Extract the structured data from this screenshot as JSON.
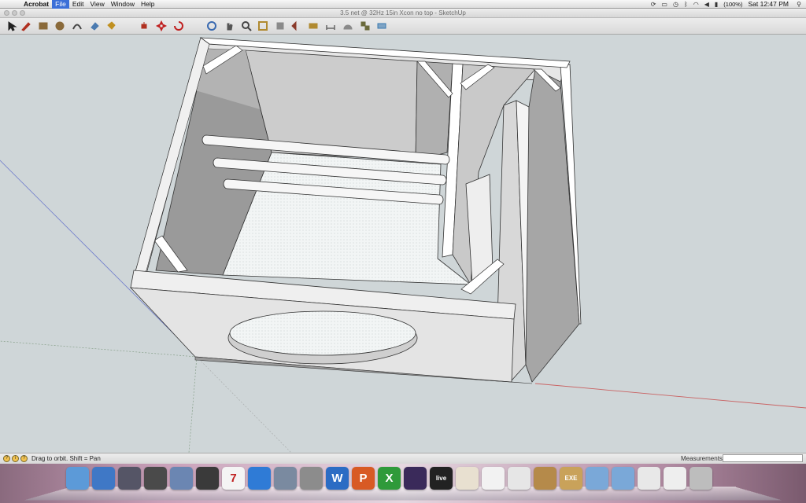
{
  "menubar": {
    "apple_glyph": "",
    "items": [
      "Acrobat",
      "File",
      "Edit",
      "View",
      "Window",
      "Help"
    ],
    "active_item": "File",
    "status": {
      "battery": "(100%)",
      "clock": "Sat 12:47 PM"
    }
  },
  "window": {
    "title": "3.5 net @ 32Hz 15in Xcon no top - SketchUp"
  },
  "toolbar": {
    "tools": [
      {
        "name": "select-tool-icon",
        "color": "#222222"
      },
      {
        "name": "pencil-tool-icon",
        "color": "#b03020"
      },
      {
        "name": "rectangle-tool-icon",
        "color": "#8a6a3a"
      },
      {
        "name": "circle-tool-icon",
        "color": "#8a6a3a"
      },
      {
        "name": "arc-tool-icon",
        "color": "#444444"
      },
      {
        "name": "eraser-tool-icon",
        "color": "#4a7ab0"
      },
      {
        "name": "paint-bucket-tool-icon",
        "color": "#c09020"
      },
      {
        "name": "push-pull-tool-icon",
        "color": "#b03020"
      },
      {
        "name": "move-tool-icon",
        "color": "#c02020"
      },
      {
        "name": "rotate-tool-icon",
        "color": "#c02020"
      },
      {
        "name": "orbit-tool-icon",
        "color": "#3a6ab0"
      },
      {
        "name": "pan-tool-icon",
        "color": "#555555"
      },
      {
        "name": "zoom-tool-icon",
        "color": "#444444"
      },
      {
        "name": "zoom-window-tool-icon",
        "color": "#b08a30"
      },
      {
        "name": "zoom-extents-tool-icon",
        "color": "#8a8a8a"
      },
      {
        "name": "previous-view-icon",
        "color": "#8a3a2a"
      },
      {
        "name": "tape-measure-tool-icon",
        "color": "#b08a30"
      },
      {
        "name": "dimension-tool-icon",
        "color": "#666666"
      },
      {
        "name": "protractor-tool-icon",
        "color": "#8a8a8a"
      },
      {
        "name": "components-icon",
        "color": "#6a6a3a"
      },
      {
        "name": "section-plane-icon",
        "color": "#3a7ab0"
      }
    ]
  },
  "statusbar": {
    "hint": "Drag to orbit.  Shift = Pan",
    "measurements_label": "Measurements",
    "measurements_value": ""
  },
  "dock": {
    "apps": [
      {
        "name": "finder-icon",
        "glyph": "",
        "bg": "#5c9ad8"
      },
      {
        "name": "safari-icon",
        "glyph": "",
        "bg": "#3f78c6"
      },
      {
        "name": "launchpad-icon",
        "glyph": "",
        "bg": "#555566"
      },
      {
        "name": "dashboard-icon",
        "glyph": "",
        "bg": "#4a4a4a"
      },
      {
        "name": "mail-icon",
        "glyph": "",
        "bg": "#6b86b2"
      },
      {
        "name": "facetime-icon",
        "glyph": "",
        "bg": "#3a3a3a"
      },
      {
        "name": "calendar-icon",
        "glyph": "7",
        "bg": "#f4f4f4"
      },
      {
        "name": "itunes-icon",
        "glyph": "",
        "bg": "#2f7bd6"
      },
      {
        "name": "iphoto-icon",
        "glyph": "",
        "bg": "#7a8aa0"
      },
      {
        "name": "system-preferences-icon",
        "glyph": "",
        "bg": "#8c8c8c"
      },
      {
        "name": "word-icon",
        "glyph": "W",
        "bg": "#2b6cc4"
      },
      {
        "name": "powerpoint-icon",
        "glyph": "P",
        "bg": "#d85a24"
      },
      {
        "name": "excel-icon",
        "glyph": "X",
        "bg": "#2f9a3a"
      },
      {
        "name": "pro-tools-icon",
        "glyph": "",
        "bg": "#3a2a5a"
      },
      {
        "name": "ableton-live-icon",
        "glyph": "live",
        "bg": "#222222"
      },
      {
        "name": "sketch-pad-icon",
        "glyph": "",
        "bg": "#e8e0d0"
      },
      {
        "name": "acrobat-icon",
        "glyph": "",
        "bg": "#f2f2f2"
      },
      {
        "name": "preview-icon",
        "glyph": "",
        "bg": "#e6e6e6"
      },
      {
        "name": "address-book-icon",
        "glyph": "",
        "bg": "#b58a4a"
      },
      {
        "name": "exe-file-icon",
        "glyph": "EXE",
        "bg": "#c9a25a"
      },
      {
        "name": "folder-icon",
        "glyph": "",
        "bg": "#7aa8d8"
      },
      {
        "name": "documents-folder-icon",
        "glyph": "",
        "bg": "#7aa8d8"
      },
      {
        "name": "window-thumbnail-icon",
        "glyph": "",
        "bg": "#e8e8e8"
      },
      {
        "name": "window-thumbnail-icon-2",
        "glyph": "",
        "bg": "#eeeeee"
      },
      {
        "name": "trash-icon",
        "glyph": "",
        "bg": "#bdbdbd"
      }
    ]
  }
}
